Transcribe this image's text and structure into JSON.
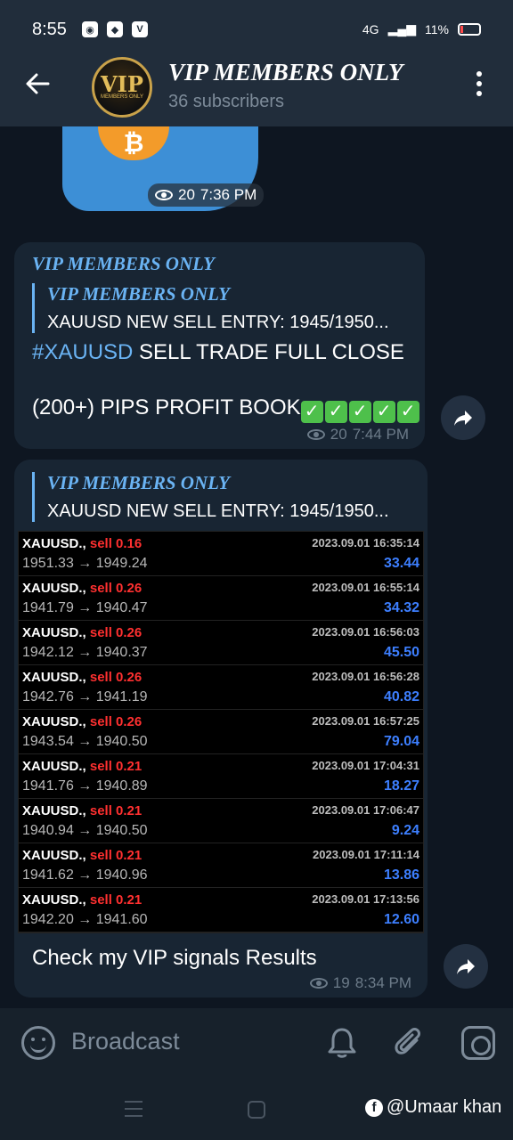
{
  "status_bar": {
    "time": "8:55",
    "network": "4G",
    "battery": "11%"
  },
  "header": {
    "title": "VIP MEMBERS ONLY",
    "subtitle": "36 subscribers",
    "avatar_text": "VIP",
    "avatar_subtext": "MEMBERS ONLY"
  },
  "sticker_message": {
    "views": "20",
    "time": "7:36 PM",
    "coin_symbol": "₿"
  },
  "message1": {
    "sender": "VIP MEMBERS ONLY",
    "quote_name": "VIP MEMBERS ONLY",
    "quote_text": "XAUUSD NEW SELL ENTRY: 1945/1950...",
    "hashtag": "#XAUUSD",
    "line1_rest": " SELL TRADE FULL CLOSE",
    "line2": "(200+) PIPS PROFIT BOOK",
    "checks": [
      "✓",
      "✓",
      "✓",
      "✓",
      "✓"
    ],
    "views": "20",
    "time": "7:44 PM"
  },
  "message2": {
    "quote_name": "VIP MEMBERS ONLY",
    "quote_text": "XAUUSD NEW SELL ENTRY: 1945/1950...",
    "caption": "Check my VIP signals Results",
    "views": "19",
    "time": "8:34 PM",
    "trades": [
      {
        "symbol": "XAUUSD.,",
        "side": "sell 0.16",
        "prices": "1951.33 → 1949.24",
        "datetime": "2023.09.01 16:35:14",
        "profit": "33.44"
      },
      {
        "symbol": "XAUUSD.,",
        "side": "sell 0.26",
        "prices": "1941.79 → 1940.47",
        "datetime": "2023.09.01 16:55:14",
        "profit": "34.32"
      },
      {
        "symbol": "XAUUSD.,",
        "side": "sell 0.26",
        "prices": "1942.12 → 1940.37",
        "datetime": "2023.09.01 16:56:03",
        "profit": "45.50"
      },
      {
        "symbol": "XAUUSD.,",
        "side": "sell 0.26",
        "prices": "1942.76 → 1941.19",
        "datetime": "2023.09.01 16:56:28",
        "profit": "40.82"
      },
      {
        "symbol": "XAUUSD.,",
        "side": "sell 0.26",
        "prices": "1943.54 → 1940.50",
        "datetime": "2023.09.01 16:57:25",
        "profit": "79.04"
      },
      {
        "symbol": "XAUUSD.,",
        "side": "sell 0.21",
        "prices": "1941.76 → 1940.89",
        "datetime": "2023.09.01 17:04:31",
        "profit": "18.27"
      },
      {
        "symbol": "XAUUSD.,",
        "side": "sell 0.21",
        "prices": "1940.94 → 1940.50",
        "datetime": "2023.09.01 17:06:47",
        "profit": "9.24"
      },
      {
        "symbol": "XAUUSD.,",
        "side": "sell 0.21",
        "prices": "1941.62 → 1940.96",
        "datetime": "2023.09.01 17:11:14",
        "profit": "13.86"
      },
      {
        "symbol": "XAUUSD.,",
        "side": "sell 0.21",
        "prices": "1942.20 → 1941.60",
        "datetime": "2023.09.01 17:13:56",
        "profit": "12.60"
      }
    ]
  },
  "composer": {
    "placeholder": "Broadcast"
  },
  "watermark": {
    "fb_letter": "f",
    "text": "@Umaar khan"
  },
  "icons": {
    "back": "arrow-left-icon",
    "menu": "more-vertical-icon",
    "views": "eye-icon",
    "forward": "share-icon",
    "emoji": "emoji-icon",
    "bell": "bell-icon",
    "attach": "paperclip-icon",
    "camera": "camera-icon"
  },
  "colors": {
    "accent": "#6ab3f3",
    "background": "#0e1621",
    "bubble": "#182533",
    "header": "#212d3b",
    "sell": "#ff3030",
    "profit": "#3d7fff"
  }
}
